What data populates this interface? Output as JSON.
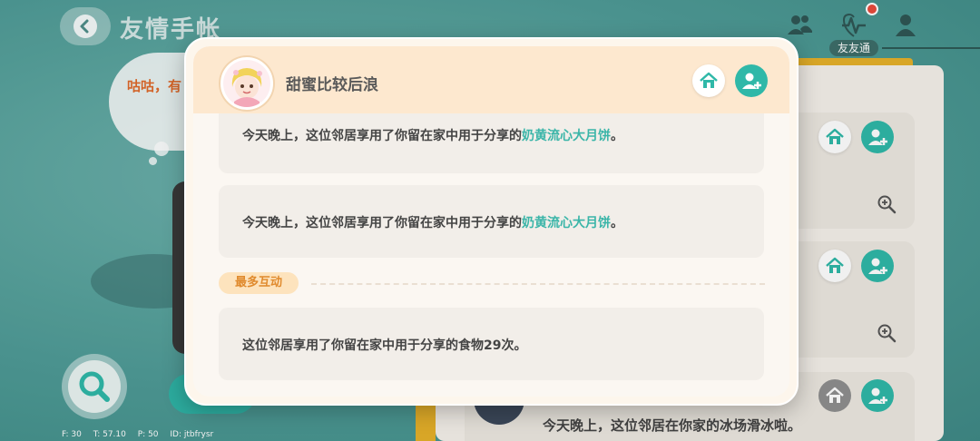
{
  "page": {
    "title": "友情手帐",
    "friend_tag": "友友通"
  },
  "bubble_text": "咕咕，有",
  "stats": [
    "F: 30",
    "T: 57.10",
    "P: 50",
    "ID: jtbfrysr"
  ],
  "bottom_row_text": "今天晚上，这位邻居在你家的冰场滑冰啦。",
  "modal": {
    "user_name": "甜蜜比较后浪",
    "messages": [
      {
        "before": "今天晚上，这位邻居享用了你留在家中用于分享的",
        "highlight": "奶黄流心大月饼",
        "after": "。"
      },
      {
        "before": "今天晚上，这位邻居享用了你留在家中用于分享的",
        "highlight": "奶黄流心大月饼",
        "after": "。"
      }
    ],
    "section_label": "最多互动",
    "top_interaction": "这位邻居享用了你留在家中用于分享的食物29次。"
  },
  "colors": {
    "accent_teal": "#3ab5a8",
    "header_peach": "#fde8cf",
    "pill_orange": "#e08a2d"
  },
  "icons": [
    "back-arrow-icon",
    "friends-icon",
    "pulse-icon",
    "friend-single-icon",
    "home-icon",
    "add-friend-icon",
    "zoom-in-icon",
    "search-icon"
  ]
}
